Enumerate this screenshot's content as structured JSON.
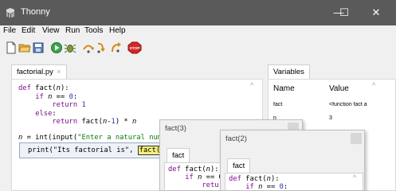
{
  "window": {
    "app_title": "Thonny",
    "minimize_glyph": "—",
    "maximize_glyph": "☐",
    "close_glyph": "✕"
  },
  "menu": [
    "File",
    "Edit",
    "View",
    "Run",
    "Tools",
    "Help"
  ],
  "toolbar": {
    "icons": [
      "new-file-icon",
      "open-file-icon",
      "save-icon",
      "run-icon",
      "debug-icon",
      "step-over-icon",
      "step-into-icon",
      "step-out-icon",
      "stop-icon"
    ],
    "stop_label": "STOP"
  },
  "editor": {
    "tab_label": "factorial.py",
    "tab_close": "×",
    "lines": [
      "def fact(n):",
      "    if n == 0:",
      "        return 1",
      "    else:",
      "        return fact(n-1) * n",
      "",
      "n = int(input(\"Enter a natural number"
    ],
    "frame_line_prefix": "print(\"Its factorial is\", ",
    "frame_line_highlight": "fact(3)",
    "frame_line_suffix": ")"
  },
  "variables": {
    "tab_label": "Variables",
    "col_name": "Name",
    "col_value": "Value",
    "rows": [
      {
        "name": "fact",
        "value": "<function fact a"
      },
      {
        "name": "n",
        "value": "3"
      }
    ]
  },
  "popups": [
    {
      "title": "fact(3)",
      "tab_label": "fact",
      "code_lines": [
        "def fact(n):",
        "    if n == 0",
        "        retur"
      ]
    },
    {
      "title": "fact(2)",
      "tab_label": "fact",
      "code_lines": [
        "def fact(n):",
        "    if n == 0:"
      ]
    }
  ],
  "scroll_glyph": "^"
}
